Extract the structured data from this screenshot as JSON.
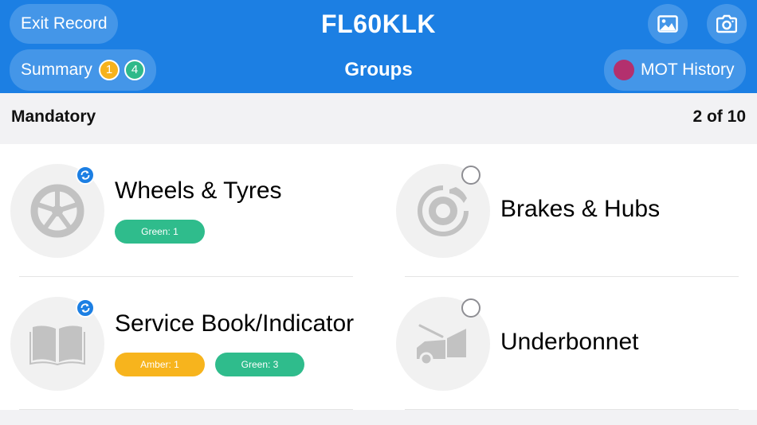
{
  "header": {
    "exit_label": "Exit Record",
    "plate": "FL60KLK",
    "title": "Groups",
    "summary_label": "Summary",
    "summary_badges": [
      {
        "value": "1",
        "color": "#f6b21c"
      },
      {
        "value": "4",
        "color": "#2fb98a"
      }
    ],
    "mot_label": "MOT History",
    "mot_dot_color": "#b3306e",
    "gallery_icon": "image-icon",
    "camera_icon": "camera-icon",
    "bg_color": "#1c7fe3"
  },
  "section": {
    "label": "Mandatory",
    "count": "2 of 10"
  },
  "groups": [
    {
      "name": "Wheels & Tyres",
      "icon": "wheel-icon",
      "status": "sync",
      "chips": [
        {
          "label": "Green: 1",
          "color": "#2fbc8c"
        }
      ]
    },
    {
      "name": "Brakes & Hubs",
      "icon": "brake-disc-icon",
      "status": "empty",
      "chips": []
    },
    {
      "name": "Service Book/Indicator",
      "icon": "book-icon",
      "status": "sync",
      "chips": [
        {
          "label": "Amber: 1",
          "color": "#f7b41d"
        },
        {
          "label": "Green: 3",
          "color": "#2fbc8c"
        }
      ]
    },
    {
      "name": "Underbonnet",
      "icon": "car-bonnet-icon",
      "status": "empty",
      "chips": []
    }
  ]
}
